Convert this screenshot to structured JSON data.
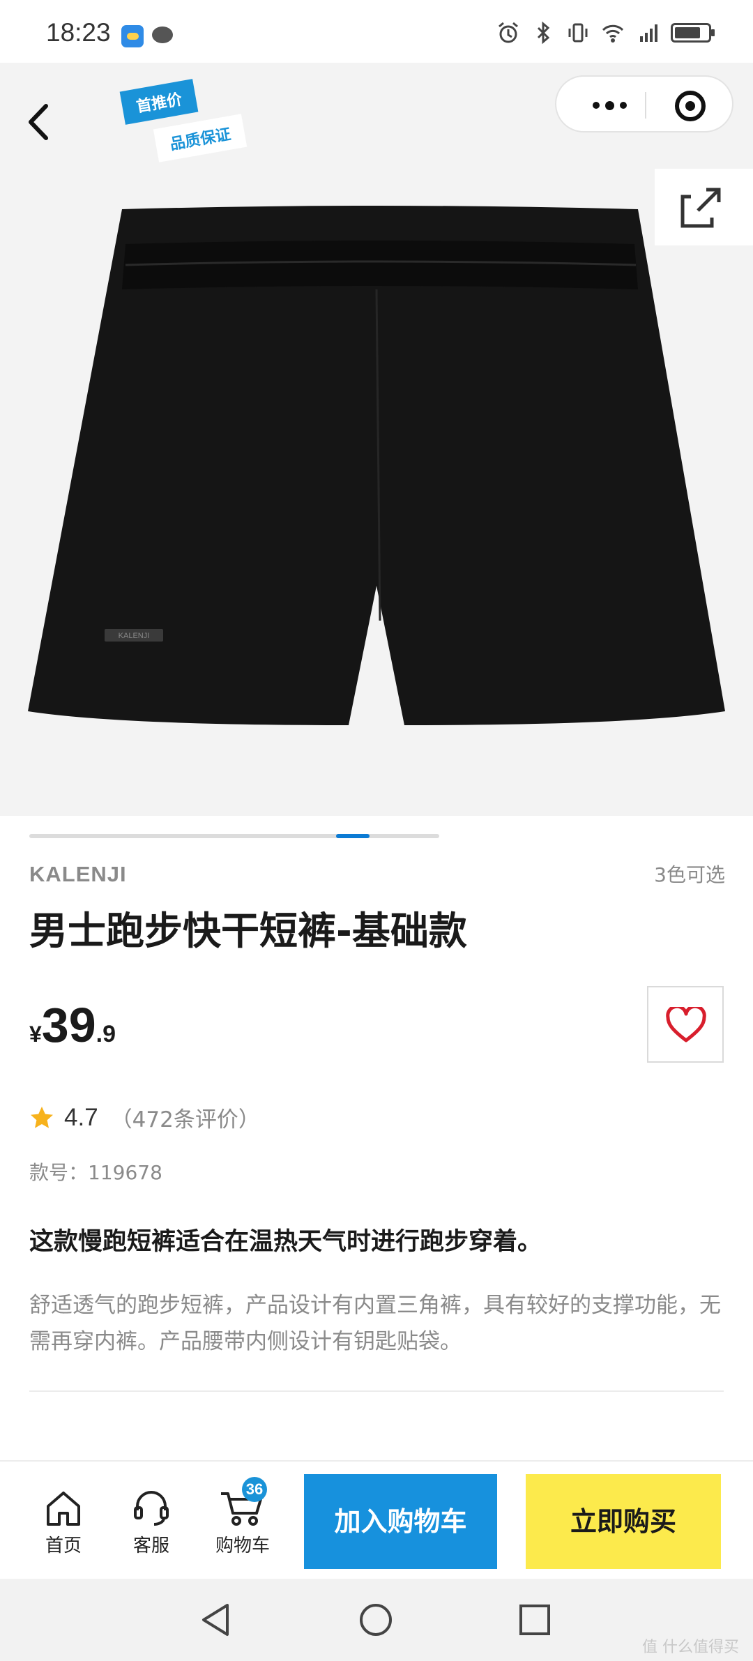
{
  "status_bar": {
    "time": "18:23"
  },
  "header": {
    "badge_primary": "首推价",
    "badge_secondary": "品质保证"
  },
  "product": {
    "brand": "KALENJI",
    "color_options": "3色可选",
    "title": "男士跑步快干短裤-基础款",
    "price": {
      "currency": "¥",
      "integer": "39",
      "decimal": ".9"
    },
    "rating": {
      "score": "4.7",
      "count_text": "（472条评价）"
    },
    "sku_text": "款号：119678",
    "tagline": "这款慢跑短裤适合在温热天气时进行跑步穿着。",
    "description": "舒适透气的跑步短裤，产品设计有内置三角裤，具有较好的支撑功能，无需再穿内裤。产品腰带内侧设计有钥匙贴袋。",
    "image_label": "KALENJI"
  },
  "bottom_bar": {
    "home_label": "首页",
    "service_label": "客服",
    "cart_label": "购物车",
    "cart_count": "36",
    "add_to_cart_label": "加入购物车",
    "buy_now_label": "立即购买"
  },
  "watermark": "值 什么值得买",
  "colors": {
    "accent_blue": "#1791dd",
    "buy_yellow": "#fcea4c",
    "star": "#f7b21c",
    "heart": "#d81e2c"
  }
}
